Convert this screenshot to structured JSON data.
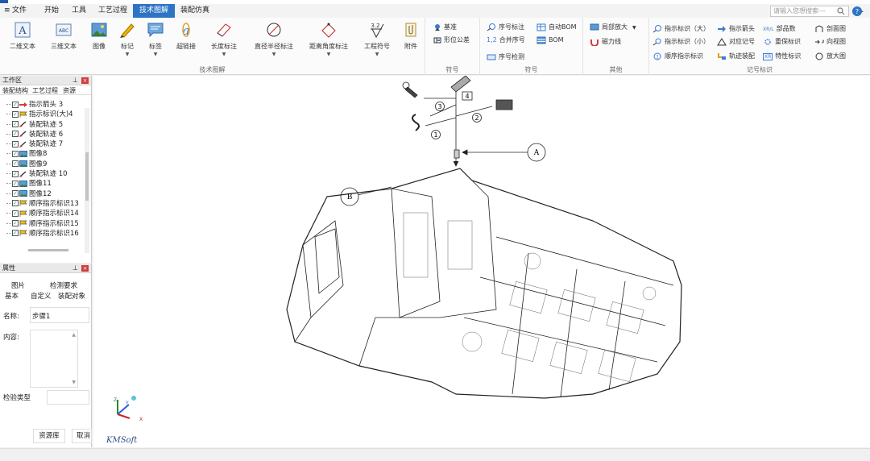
{
  "menu": {
    "icon": "hamburger-icon",
    "items": [
      "文件",
      "开始",
      "工具",
      "工艺过程",
      "技术图解",
      "装配仿真"
    ],
    "active_index": 4
  },
  "search": {
    "placeholder": "请输入您想搜索---"
  },
  "ribbon": {
    "group1": {
      "title": "技术图解",
      "buttons": [
        "二维文本",
        "三维文本",
        "图像",
        "标记",
        "标签",
        "超链接",
        "长度标注",
        "直径半径标注",
        "距离角度标注",
        "工程符号",
        "附件"
      ],
      "engineering_symbol_text": "3.2"
    },
    "group2": {
      "title": "符号",
      "buttons": [
        "基准",
        "形位公差"
      ]
    },
    "group3": {
      "title": "符号",
      "buttons": [
        "序号标注",
        "合并序号",
        "序号检测",
        "自动BOM",
        "BOM"
      ],
      "serial_icon_text": "1,2"
    },
    "group4": {
      "title": "其他",
      "buttons": [
        "局部放大",
        "磁力线"
      ]
    },
    "group5": {
      "title": "记号标识",
      "buttons": [
        "指示标识（大）",
        "指示标识（小）",
        "顺序指示标识",
        "指示箭头",
        "对应记号",
        "轨迹装配",
        "部品数",
        "重保标识",
        "特性标识",
        "剖面图",
        "向视图",
        "放大图"
      ],
      "icon_texts": [
        "XR/L",
        "XR"
      ]
    }
  },
  "workspace": {
    "title": "工作区",
    "tabs": [
      "装配结构",
      "工艺过程",
      "资源"
    ],
    "items": [
      "指示箭头 3",
      "指示标识(大)4",
      "装配轨迹 5",
      "装配轨迹 6",
      "装配轨迹 7",
      "图像8",
      "图像9",
      "装配轨迹 10",
      "图像11",
      "图像12",
      "顺序指示标识13",
      "顺序指示标识14",
      "顺序指示标识15",
      "顺序指示标识16"
    ],
    "item_icons": [
      "arrow-icon",
      "flag-icon",
      "trajectory-icon",
      "trajectory-icon",
      "trajectory-icon",
      "image-icon",
      "image-icon",
      "trajectory-icon",
      "image-icon",
      "image-icon",
      "flag-icon",
      "flag-icon",
      "flag-icon",
      "flag-icon"
    ]
  },
  "properties": {
    "title": "属性",
    "tabs_row1": [
      "图片",
      "检测要求"
    ],
    "tabs_row2": [
      "基本",
      "自定义",
      "装配对象"
    ],
    "name_label": "名称:",
    "name_value": "步骤1",
    "content_label": "内容:",
    "inspection_label": "检验类型",
    "resource_button": "资源库",
    "cancel_button": "取消"
  },
  "canvas": {
    "balloons": [
      "A",
      "B"
    ],
    "tool_numbers": [
      "1",
      "2",
      "3",
      "4"
    ],
    "axis_labels": [
      "Z",
      "Y",
      "X"
    ],
    "watermark": "KMSoft"
  },
  "colors": {
    "accent": "#2d74c4",
    "close": "#d33a3a"
  }
}
